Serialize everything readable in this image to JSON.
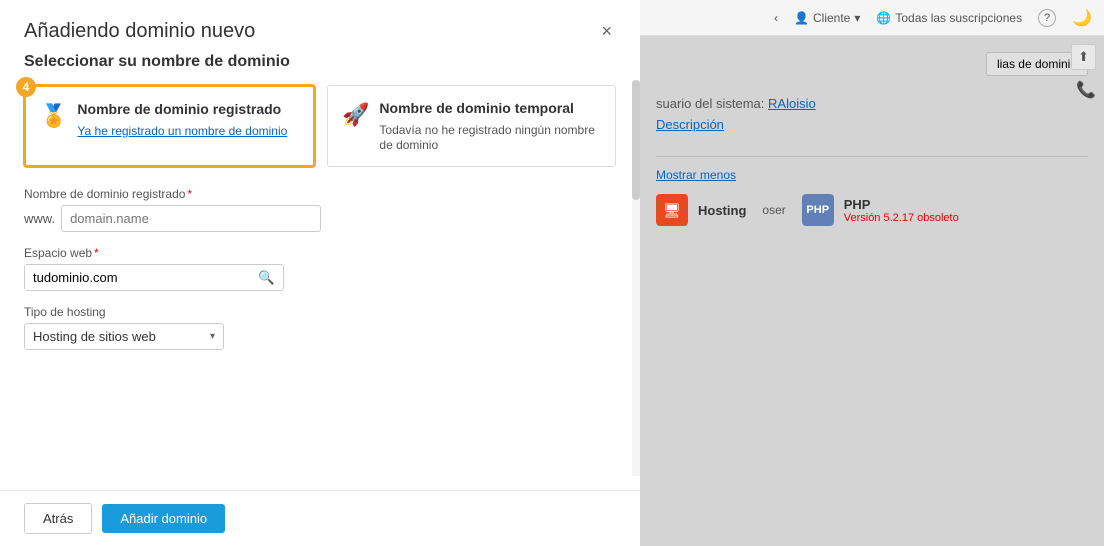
{
  "modal": {
    "title": "Añadiendo dominio nuevo",
    "close_label": "×",
    "step_section_label": "Seleccionar su nombre de dominio",
    "step_number": "4",
    "option_registered": {
      "title": "Nombre de dominio registrado",
      "desc": "Ya he registrado un nombre de dominio"
    },
    "option_temp": {
      "title": "Nombre de dominio temporal",
      "desc": "Todavía no he registrado ningún nombre de dominio"
    },
    "field_domain_label": "Nombre de dominio registrado",
    "field_domain_required": "*",
    "field_domain_prefix": "www.",
    "field_domain_placeholder": "domain.name",
    "field_webspace_label": "Espacio web",
    "field_webspace_required": "*",
    "field_webspace_value": "tudominio.com",
    "field_hosting_label": "Tipo de hosting",
    "field_hosting_value": "Hosting de sitios web",
    "btn_back": "Atrás",
    "btn_add": "Añadir dominio"
  },
  "topbar": {
    "client_label": "Cliente",
    "subscriptions_label": "Todas las suscripciones",
    "help_icon": "?",
    "user_icon": ")"
  },
  "rightpanel": {
    "domain_alias_btn": "lias de dominio",
    "export_btn": "⬆",
    "system_user_label": "suario del sistema:",
    "system_user_value": "RAloisio",
    "description_label": "Descripción",
    "show_less_btn": "Mostrar menos",
    "hosting_label": "Hosting",
    "php_label": "PHP",
    "php_version": "Versión 5.2.17 obsoleto",
    "composer_label": "oser"
  }
}
